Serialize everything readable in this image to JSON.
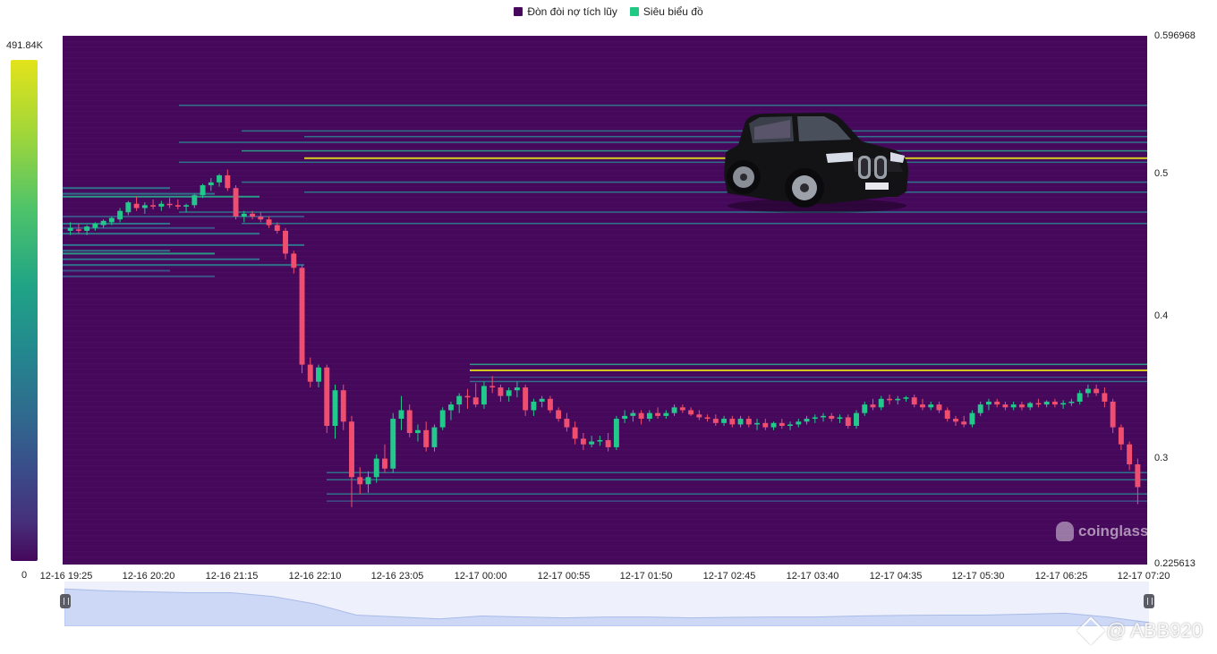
{
  "legend": {
    "series1_label": "Đòn đòi nợ tích lũy",
    "series1_color": "#45085b",
    "series2_label": "Siêu biểu đồ",
    "series2_color": "#1fc983"
  },
  "colorbar": {
    "max_label": "491.84K",
    "min_label": "0"
  },
  "watermark": {
    "text": "coinglass"
  },
  "credit": {
    "text": "@ ABB920"
  },
  "chart_data": {
    "type": "heatmap",
    "ylim": [
      0.225613,
      0.596968
    ],
    "y_tick_labels": [
      {
        "value": 0.596968,
        "label": "0.596968"
      },
      {
        "value": 0.5,
        "label": "0.5"
      },
      {
        "value": 0.4,
        "label": "0.4"
      },
      {
        "value": 0.3,
        "label": "0.3"
      },
      {
        "value": 0.225613,
        "label": "0.225613"
      }
    ],
    "x_tick_labels": [
      "12-16 19:25",
      "12-16 20:20",
      "12-16 21:15",
      "12-16 22:10",
      "12-16 23:05",
      "12-17 00:00",
      "12-17 00:55",
      "12-17 01:50",
      "12-17 02:45",
      "12-17 03:40",
      "12-17 04:35",
      "12-17 05:30",
      "12-17 06:25",
      "12-17 07:20"
    ],
    "candles": [
      [
        0.46,
        0.466,
        0.457,
        0.462
      ],
      [
        0.461,
        0.465,
        0.458,
        0.46
      ],
      [
        0.46,
        0.464,
        0.457,
        0.463
      ],
      [
        0.462,
        0.466,
        0.46,
        0.465
      ],
      [
        0.464,
        0.468,
        0.462,
        0.467
      ],
      [
        0.466,
        0.47,
        0.464,
        0.469
      ],
      [
        0.468,
        0.476,
        0.466,
        0.474
      ],
      [
        0.473,
        0.481,
        0.471,
        0.48
      ],
      [
        0.479,
        0.484,
        0.474,
        0.476
      ],
      [
        0.476,
        0.48,
        0.472,
        0.478
      ],
      [
        0.478,
        0.482,
        0.475,
        0.477
      ],
      [
        0.477,
        0.481,
        0.474,
        0.479
      ],
      [
        0.479,
        0.483,
        0.476,
        0.478
      ],
      [
        0.478,
        0.482,
        0.475,
        0.477
      ],
      [
        0.477,
        0.479,
        0.473,
        0.478
      ],
      [
        0.478,
        0.486,
        0.476,
        0.485
      ],
      [
        0.485,
        0.493,
        0.483,
        0.492
      ],
      [
        0.492,
        0.497,
        0.488,
        0.494
      ],
      [
        0.494,
        0.5,
        0.491,
        0.499
      ],
      [
        0.499,
        0.503,
        0.488,
        0.49
      ],
      [
        0.49,
        0.492,
        0.468,
        0.47
      ],
      [
        0.47,
        0.474,
        0.466,
        0.472
      ],
      [
        0.472,
        0.474,
        0.468,
        0.47
      ],
      [
        0.47,
        0.473,
        0.466,
        0.468
      ],
      [
        0.468,
        0.47,
        0.462,
        0.464
      ],
      [
        0.464,
        0.466,
        0.458,
        0.46
      ],
      [
        0.46,
        0.462,
        0.44,
        0.444
      ],
      [
        0.444,
        0.446,
        0.43,
        0.434
      ],
      [
        0.434,
        0.436,
        0.36,
        0.366
      ],
      [
        0.366,
        0.371,
        0.35,
        0.354
      ],
      [
        0.354,
        0.366,
        0.35,
        0.364
      ],
      [
        0.364,
        0.366,
        0.318,
        0.323
      ],
      [
        0.323,
        0.352,
        0.314,
        0.348
      ],
      [
        0.348,
        0.352,
        0.32,
        0.326
      ],
      [
        0.326,
        0.33,
        0.266,
        0.287
      ],
      [
        0.287,
        0.294,
        0.275,
        0.282
      ],
      [
        0.282,
        0.291,
        0.276,
        0.287
      ],
      [
        0.287,
        0.303,
        0.283,
        0.3
      ],
      [
        0.3,
        0.31,
        0.29,
        0.293
      ],
      [
        0.293,
        0.332,
        0.29,
        0.328
      ],
      [
        0.328,
        0.344,
        0.32,
        0.334
      ],
      [
        0.334,
        0.338,
        0.315,
        0.318
      ],
      [
        0.318,
        0.324,
        0.312,
        0.32
      ],
      [
        0.32,
        0.326,
        0.305,
        0.308
      ],
      [
        0.308,
        0.324,
        0.305,
        0.322
      ],
      [
        0.322,
        0.336,
        0.32,
        0.334
      ],
      [
        0.334,
        0.34,
        0.327,
        0.338
      ],
      [
        0.338,
        0.346,
        0.332,
        0.344
      ],
      [
        0.344,
        0.349,
        0.335,
        0.343
      ],
      [
        0.343,
        0.353,
        0.336,
        0.338
      ],
      [
        0.338,
        0.354,
        0.335,
        0.351
      ],
      [
        0.351,
        0.358,
        0.346,
        0.35
      ],
      [
        0.35,
        0.352,
        0.34,
        0.344
      ],
      [
        0.344,
        0.35,
        0.34,
        0.348
      ],
      [
        0.348,
        0.354,
        0.343,
        0.35
      ],
      [
        0.35,
        0.352,
        0.33,
        0.334
      ],
      [
        0.334,
        0.342,
        0.33,
        0.34
      ],
      [
        0.34,
        0.344,
        0.336,
        0.342
      ],
      [
        0.342,
        0.344,
        0.332,
        0.334
      ],
      [
        0.334,
        0.336,
        0.326,
        0.328
      ],
      [
        0.328,
        0.332,
        0.319,
        0.322
      ],
      [
        0.322,
        0.326,
        0.31,
        0.314
      ],
      [
        0.314,
        0.318,
        0.306,
        0.31
      ],
      [
        0.31,
        0.316,
        0.308,
        0.312
      ],
      [
        0.312,
        0.316,
        0.309,
        0.313
      ],
      [
        0.313,
        0.318,
        0.305,
        0.308
      ],
      [
        0.308,
        0.33,
        0.306,
        0.328
      ],
      [
        0.328,
        0.334,
        0.325,
        0.33
      ],
      [
        0.33,
        0.334,
        0.326,
        0.332
      ],
      [
        0.332,
        0.334,
        0.324,
        0.328
      ],
      [
        0.328,
        0.334,
        0.326,
        0.332
      ],
      [
        0.332,
        0.336,
        0.328,
        0.33
      ],
      [
        0.33,
        0.334,
        0.328,
        0.332
      ],
      [
        0.332,
        0.338,
        0.33,
        0.336
      ],
      [
        0.336,
        0.338,
        0.332,
        0.334
      ],
      [
        0.334,
        0.336,
        0.33,
        0.331
      ],
      [
        0.331,
        0.334,
        0.327,
        0.329
      ],
      [
        0.329,
        0.331,
        0.326,
        0.328
      ],
      [
        0.328,
        0.331,
        0.323,
        0.325
      ],
      [
        0.325,
        0.33,
        0.323,
        0.328
      ],
      [
        0.328,
        0.33,
        0.322,
        0.324
      ],
      [
        0.324,
        0.33,
        0.322,
        0.328
      ],
      [
        0.328,
        0.33,
        0.322,
        0.324
      ],
      [
        0.324,
        0.328,
        0.32,
        0.325
      ],
      [
        0.325,
        0.328,
        0.32,
        0.322
      ],
      [
        0.322,
        0.326,
        0.32,
        0.325
      ],
      [
        0.325,
        0.328,
        0.321,
        0.323
      ],
      [
        0.323,
        0.326,
        0.32,
        0.324
      ],
      [
        0.324,
        0.328,
        0.322,
        0.326
      ],
      [
        0.326,
        0.33,
        0.324,
        0.328
      ],
      [
        0.328,
        0.331,
        0.325,
        0.329
      ],
      [
        0.329,
        0.332,
        0.326,
        0.33
      ],
      [
        0.33,
        0.332,
        0.326,
        0.328
      ],
      [
        0.328,
        0.331,
        0.325,
        0.329
      ],
      [
        0.329,
        0.331,
        0.321,
        0.323
      ],
      [
        0.323,
        0.334,
        0.321,
        0.332
      ],
      [
        0.332,
        0.34,
        0.33,
        0.338
      ],
      [
        0.338,
        0.342,
        0.334,
        0.336
      ],
      [
        0.336,
        0.344,
        0.334,
        0.342
      ],
      [
        0.342,
        0.345,
        0.338,
        0.341
      ],
      [
        0.341,
        0.344,
        0.338,
        0.342
      ],
      [
        0.342,
        0.344,
        0.34,
        0.343
      ],
      [
        0.343,
        0.345,
        0.336,
        0.338
      ],
      [
        0.338,
        0.342,
        0.334,
        0.336
      ],
      [
        0.336,
        0.34,
        0.334,
        0.338
      ],
      [
        0.338,
        0.34,
        0.332,
        0.334
      ],
      [
        0.334,
        0.336,
        0.326,
        0.328
      ],
      [
        0.328,
        0.33,
        0.323,
        0.326
      ],
      [
        0.326,
        0.33,
        0.322,
        0.324
      ],
      [
        0.324,
        0.334,
        0.322,
        0.332
      ],
      [
        0.332,
        0.34,
        0.33,
        0.338
      ],
      [
        0.338,
        0.342,
        0.334,
        0.34
      ],
      [
        0.34,
        0.342,
        0.336,
        0.338
      ],
      [
        0.338,
        0.34,
        0.334,
        0.336
      ],
      [
        0.336,
        0.34,
        0.334,
        0.338
      ],
      [
        0.338,
        0.34,
        0.334,
        0.336
      ],
      [
        0.336,
        0.34,
        0.334,
        0.339
      ],
      [
        0.339,
        0.342,
        0.336,
        0.338
      ],
      [
        0.338,
        0.341,
        0.336,
        0.34
      ],
      [
        0.34,
        0.342,
        0.336,
        0.338
      ],
      [
        0.338,
        0.341,
        0.335,
        0.339
      ],
      [
        0.339,
        0.342,
        0.337,
        0.34
      ],
      [
        0.34,
        0.348,
        0.338,
        0.346
      ],
      [
        0.346,
        0.352,
        0.343,
        0.349
      ],
      [
        0.349,
        0.352,
        0.344,
        0.346
      ],
      [
        0.346,
        0.35,
        0.336,
        0.34
      ],
      [
        0.34,
        0.342,
        0.318,
        0.322
      ],
      [
        0.322,
        0.324,
        0.306,
        0.31
      ],
      [
        0.31,
        0.312,
        0.292,
        0.296
      ],
      [
        0.296,
        0.3,
        0.268,
        0.28
      ]
    ],
    "liquidity_levels_left": [
      {
        "price": 0.49,
        "intensity": 0.5
      },
      {
        "price": 0.486,
        "intensity": 0.55
      },
      {
        "price": 0.484,
        "intensity": 0.6
      },
      {
        "price": 0.47,
        "intensity": 0.35
      },
      {
        "price": 0.465,
        "intensity": 0.45
      },
      {
        "price": 0.462,
        "intensity": 0.4
      },
      {
        "price": 0.458,
        "intensity": 0.5
      },
      {
        "price": 0.45,
        "intensity": 0.55
      },
      {
        "price": 0.446,
        "intensity": 0.5
      },
      {
        "price": 0.444,
        "intensity": 0.65
      },
      {
        "price": 0.44,
        "intensity": 0.55
      },
      {
        "price": 0.436,
        "intensity": 0.45
      },
      {
        "price": 0.432,
        "intensity": 0.4
      },
      {
        "price": 0.428,
        "intensity": 0.35
      }
    ],
    "liquidity_levels_right": [
      {
        "price": 0.548,
        "intensity": 0.45
      },
      {
        "price": 0.53,
        "intensity": 0.5
      },
      {
        "price": 0.526,
        "intensity": 0.55
      },
      {
        "price": 0.522,
        "intensity": 0.45
      },
      {
        "price": 0.516,
        "intensity": 0.6
      },
      {
        "price": 0.511,
        "intensity": 1.0
      },
      {
        "price": 0.508,
        "intensity": 0.55
      },
      {
        "price": 0.494,
        "intensity": 0.5
      },
      {
        "price": 0.487,
        "intensity": 0.55
      },
      {
        "price": 0.473,
        "intensity": 0.5
      },
      {
        "price": 0.465,
        "intensity": 0.45
      },
      {
        "price": 0.366,
        "intensity": 0.7
      },
      {
        "price": 0.362,
        "intensity": 1.0
      },
      {
        "price": 0.357,
        "intensity": 0.4
      },
      {
        "price": 0.354,
        "intensity": 0.45
      },
      {
        "price": 0.29,
        "intensity": 0.5
      },
      {
        "price": 0.285,
        "intensity": 0.45
      },
      {
        "price": 0.275,
        "intensity": 0.5
      },
      {
        "price": 0.27,
        "intensity": 0.4
      }
    ],
    "navigator_values": [
      0.48,
      0.47,
      0.465,
      0.46,
      0.46,
      0.44,
      0.4,
      0.34,
      0.33,
      0.32,
      0.335,
      0.33,
      0.325,
      0.33,
      0.33,
      0.325,
      0.328,
      0.33,
      0.33,
      0.335,
      0.338,
      0.34,
      0.34,
      0.345,
      0.35,
      0.33,
      0.3
    ]
  }
}
